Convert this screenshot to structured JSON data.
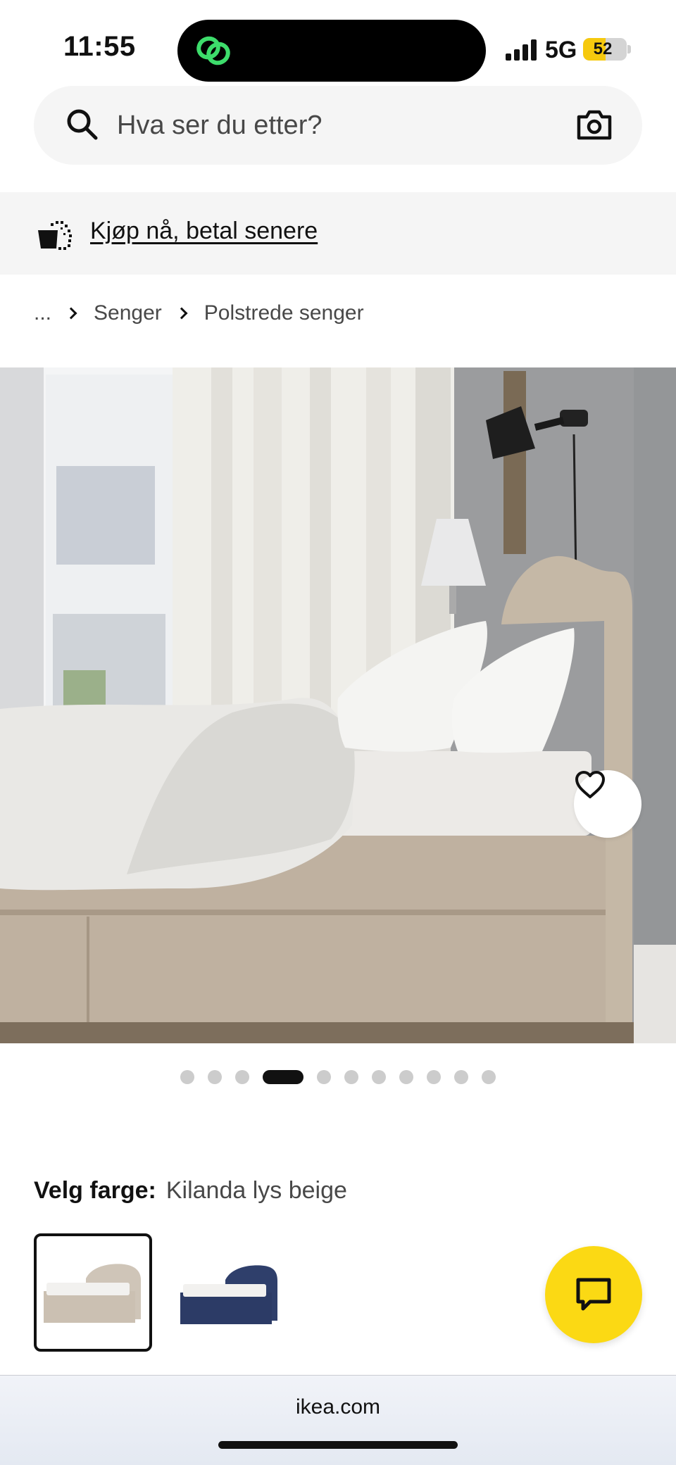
{
  "status_bar": {
    "time": "11:55",
    "network": "5G",
    "battery_level": "52",
    "battery_fraction": 0.52
  },
  "search": {
    "placeholder": "Hva ser du etter?",
    "icon": "search-icon",
    "camera_icon": "camera-icon"
  },
  "promo": {
    "text": "Kjøp nå, betal senere",
    "icon": "bag-icon"
  },
  "breadcrumb": {
    "items": [
      "...",
      "Senger",
      "Polstrede senger"
    ]
  },
  "gallery": {
    "dot_count": 11,
    "active_index": 3,
    "favorite_icon": "heart-icon"
  },
  "color_select": {
    "label": "Velg farge:",
    "value": "Kilanda lys beige",
    "options": [
      {
        "name": "Kilanda lys beige",
        "color": "#cfc5b8",
        "selected": true
      },
      {
        "name": "dark blue",
        "color": "#2f3f6b",
        "selected": false
      }
    ]
  },
  "chat": {
    "icon": "chat-icon",
    "color": "#fbd914"
  },
  "browser": {
    "url": "ikea.com"
  }
}
